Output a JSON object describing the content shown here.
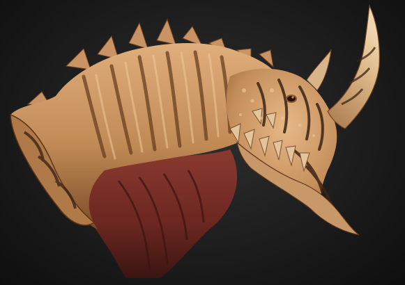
{
  "scene": {
    "subject": "creature-bust",
    "colors": {
      "background_center": "#2f2f2f",
      "background_edge": "#0e0e0e",
      "skin_light": "#d9a673",
      "skin_mid": "#b9824f",
      "skin_dark": "#6e4424",
      "stripe": "#3d2414",
      "neck_flesh": "#7a2f28",
      "neck_flesh_dark": "#4a1a17",
      "horn": "#d8b284",
      "tooth": "#e4c49a"
    }
  }
}
